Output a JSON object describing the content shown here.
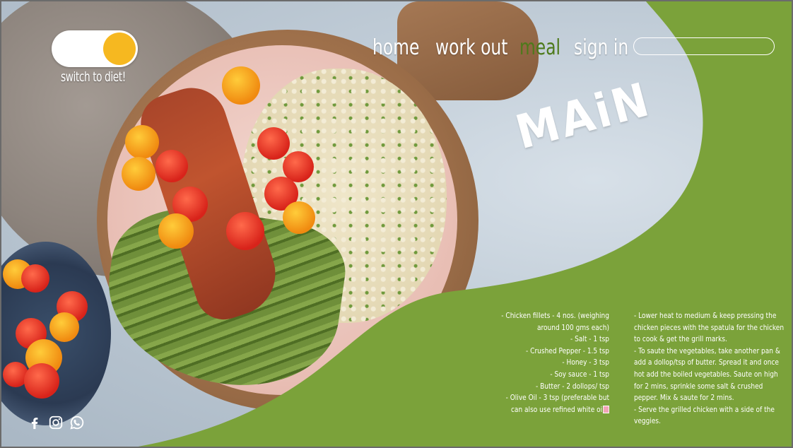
{
  "toggle": {
    "caption": "switch to diet!",
    "knob_color": "#f6b820"
  },
  "nav": {
    "links": [
      {
        "label": "home",
        "active": false
      },
      {
        "label": "work out",
        "active": false
      },
      {
        "label": "meal",
        "active": true
      },
      {
        "label": "sign in",
        "active": false
      }
    ],
    "search": {
      "value": "",
      "placeholder": ""
    }
  },
  "hero": {
    "title": "MAiN"
  },
  "recipe": {
    "ingredients": [
      "- Chicken fillets - 4 nos. (weighing around 100 gms each)",
      "- Salt - 1 tsp",
      "- Crushed Pepper - 1.5 tsp",
      "- Honey - 3 tsp",
      "- Soy sauce - 1 tsp",
      "- Butter - 2 dollops/ tsp",
      "- Olive Oil - 3 tsp (preferable but can also use refined white oi"
    ],
    "steps": [
      "- Lower heat to medium & keep pressing the chicken pieces with the spatula for the chicken to cook & get the grill marks.",
      "- To saute the vegetables, take another pan & add a dollop/tsp of butter. Spread it and once hot add the boiled vegetables. Saute on high for 2 mins, sprinkle some salt & crushed pepper. Mix & saute for 2 mins.",
      "- Serve the grilled chicken with a side of the veggies."
    ]
  },
  "social": [
    "facebook-icon",
    "instagram-icon",
    "whatsapp-icon"
  ],
  "colors": {
    "accent_green": "#7ba23a",
    "active_nav": "#4d7a1a",
    "text": "#ffffff"
  }
}
